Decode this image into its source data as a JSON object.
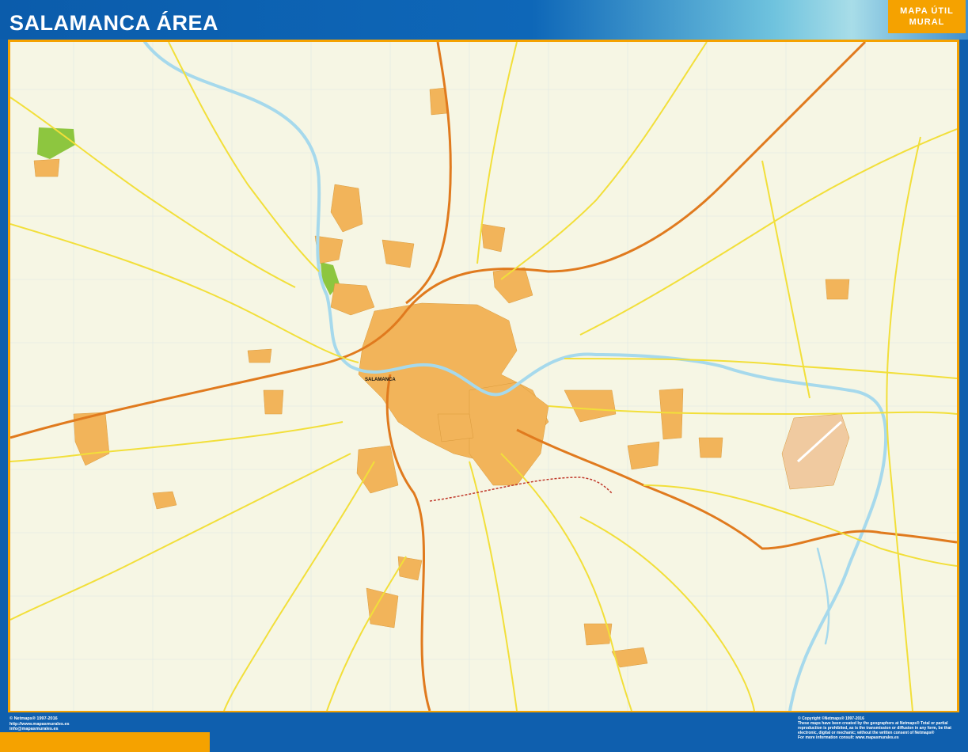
{
  "header": {
    "title": "SALAMANCA ÁREA",
    "brand_line1": "MAPA ÚTIL",
    "brand_line2": "MURAL"
  },
  "map": {
    "city_label": "SALAMANCA",
    "colors": {
      "background": "#f6f6e4",
      "urban": "#f2b45a",
      "river": "#a6d9ec",
      "motorway": "#e07a1e",
      "main_road": "#f2df3a",
      "park": "#8dc63f",
      "frame": "#f5a200",
      "header_blue": "#0f5fae"
    }
  },
  "footer": {
    "left": {
      "copyright": "© Netmaps® 1997-2016",
      "url": "http://www.mapasmurales.es",
      "email": "info@mapasmurales.es"
    },
    "right": {
      "copyright": "© Copyright ©Netmaps® 1997-2016",
      "line1": "These maps have been created by the geographers at Netmaps® Total or partial",
      "line2": "reproduction is prohibited, as is the transmission or diffusion in any form, be that",
      "line3": "electronic, digital or mechanic; without the written consent of Netmaps®",
      "line4": "For more information consult: www.mapasmurales.es"
    }
  }
}
